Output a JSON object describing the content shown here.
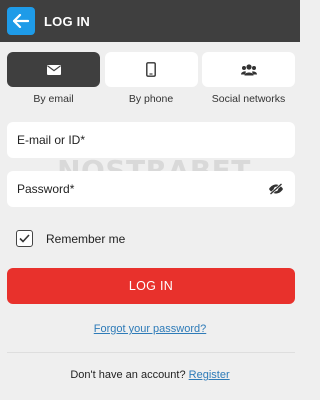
{
  "header": {
    "title": "LOG IN",
    "back_icon": "arrow-left-icon",
    "accent": "#1e9be8",
    "background": "#3f3f3f"
  },
  "methods": [
    {
      "label": "By email",
      "icon": "envelope-icon",
      "active": true
    },
    {
      "label": "By phone",
      "icon": "phone-icon",
      "active": false
    },
    {
      "label": "Social networks",
      "icon": "users-icon",
      "active": false
    }
  ],
  "form": {
    "email_placeholder": "E-mail or ID*",
    "email_value": "",
    "password_placeholder": "Password*",
    "password_value": "",
    "password_toggle_icon": "eye-off-icon",
    "remember_label": "Remember me",
    "remember_checked": true,
    "submit_label": "LOG IN",
    "submit_color": "#e8312c"
  },
  "watermark": "NOSTRABET",
  "forgot_password": "Forgot your password?",
  "register": {
    "prompt": "Don't have an account?",
    "link": "Register"
  },
  "link_color": "#2e7bb8"
}
